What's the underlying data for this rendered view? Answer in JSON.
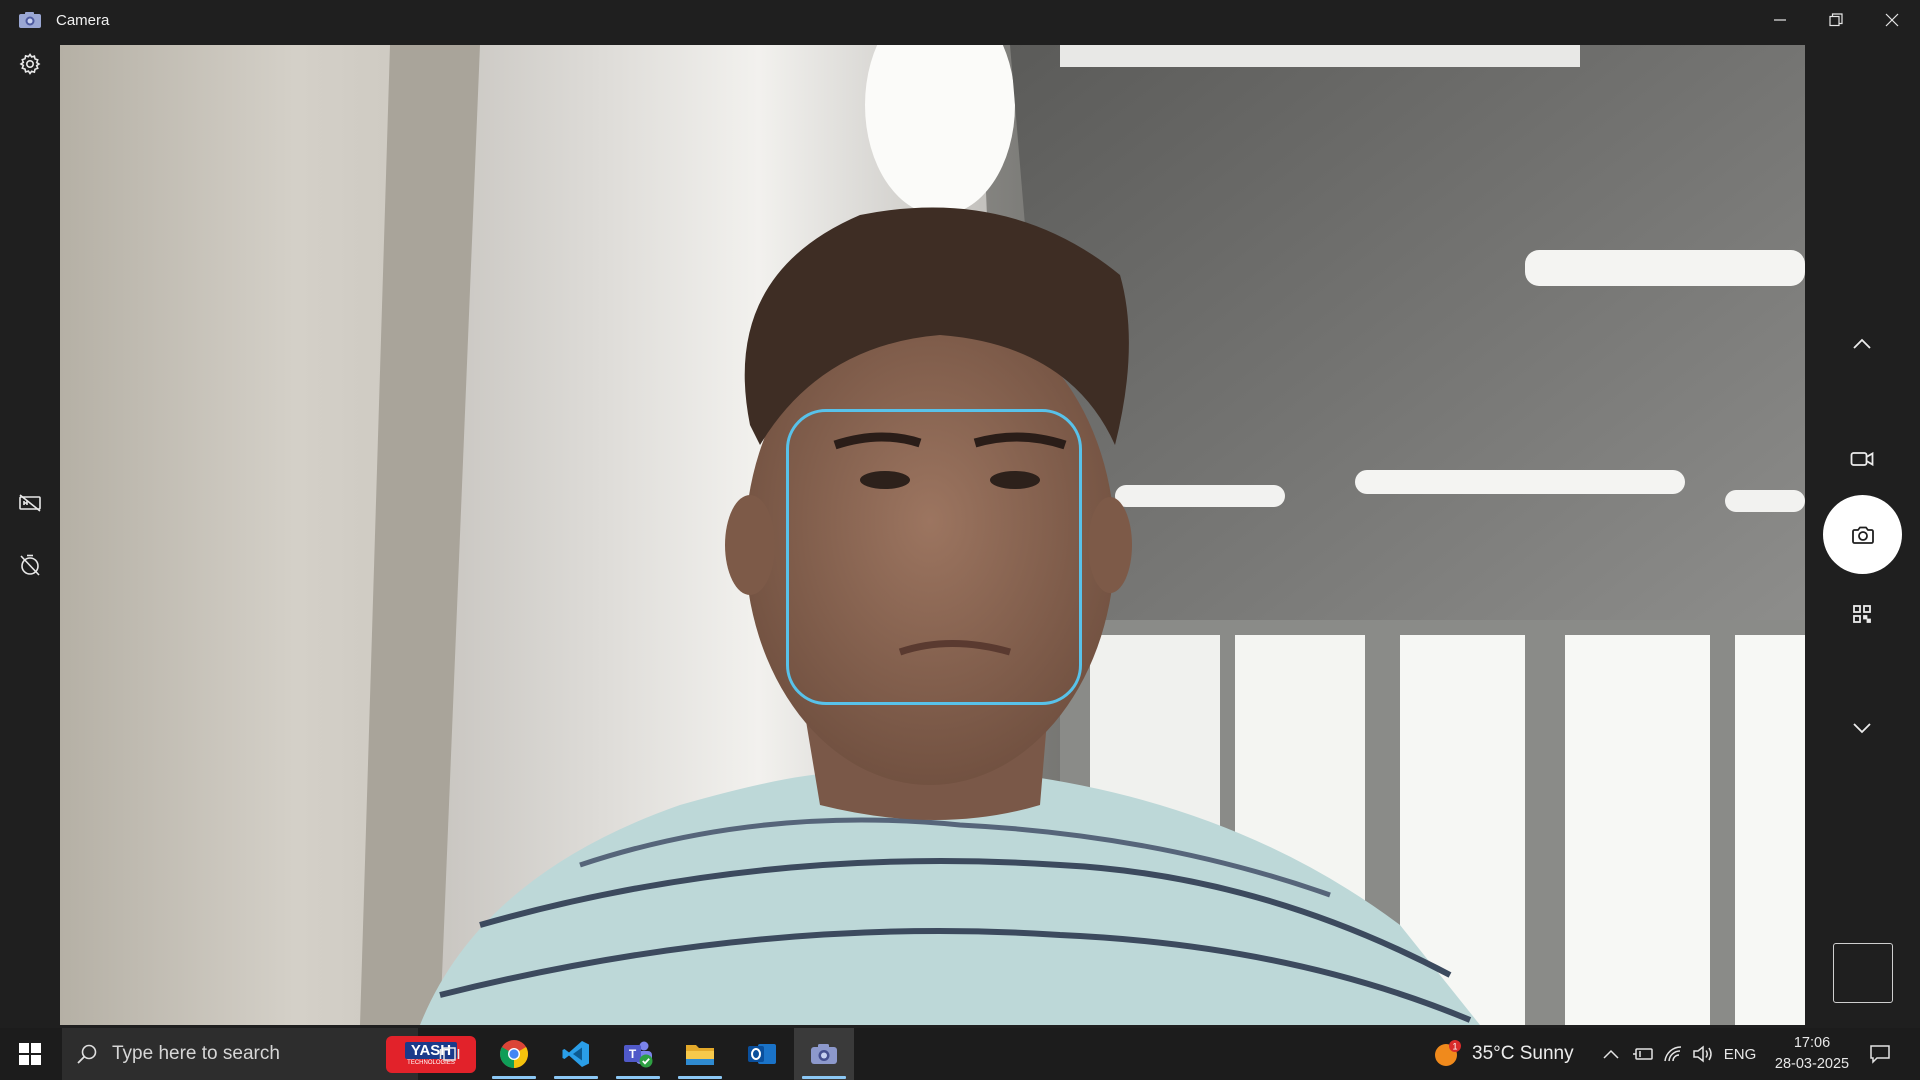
{
  "window": {
    "title": "Camera",
    "minimize_label": "Minimize",
    "maximize_label": "Restore",
    "close_label": "Close"
  },
  "left_rail": {
    "settings": "settings-icon",
    "hdr": "hdr-off-icon",
    "timer": "timer-off-icon"
  },
  "preview": {
    "face_box_color": "#58c2ea"
  },
  "right_rail": {
    "scroll_up": "chevron-up-icon",
    "video_mode": "video-camera-icon",
    "photo_mode": "camera-icon",
    "qr_mode": "qr-code-icon",
    "scroll_down": "chevron-down-icon"
  },
  "taskbar": {
    "search_placeholder": "Type here to search",
    "yash_logo_text": "YASH",
    "yash_logo_sub": "TECHNOLOGIES",
    "apps": [
      "task-view-icon",
      "chrome-icon",
      "vscode-icon",
      "teams-icon",
      "file-explorer-icon",
      "outlook-icon",
      "camera-app-icon"
    ],
    "weather": {
      "text": "35°C  Sunny",
      "badge": "1"
    },
    "language": "ENG",
    "time": "17:06",
    "date": "28-03-2025"
  }
}
